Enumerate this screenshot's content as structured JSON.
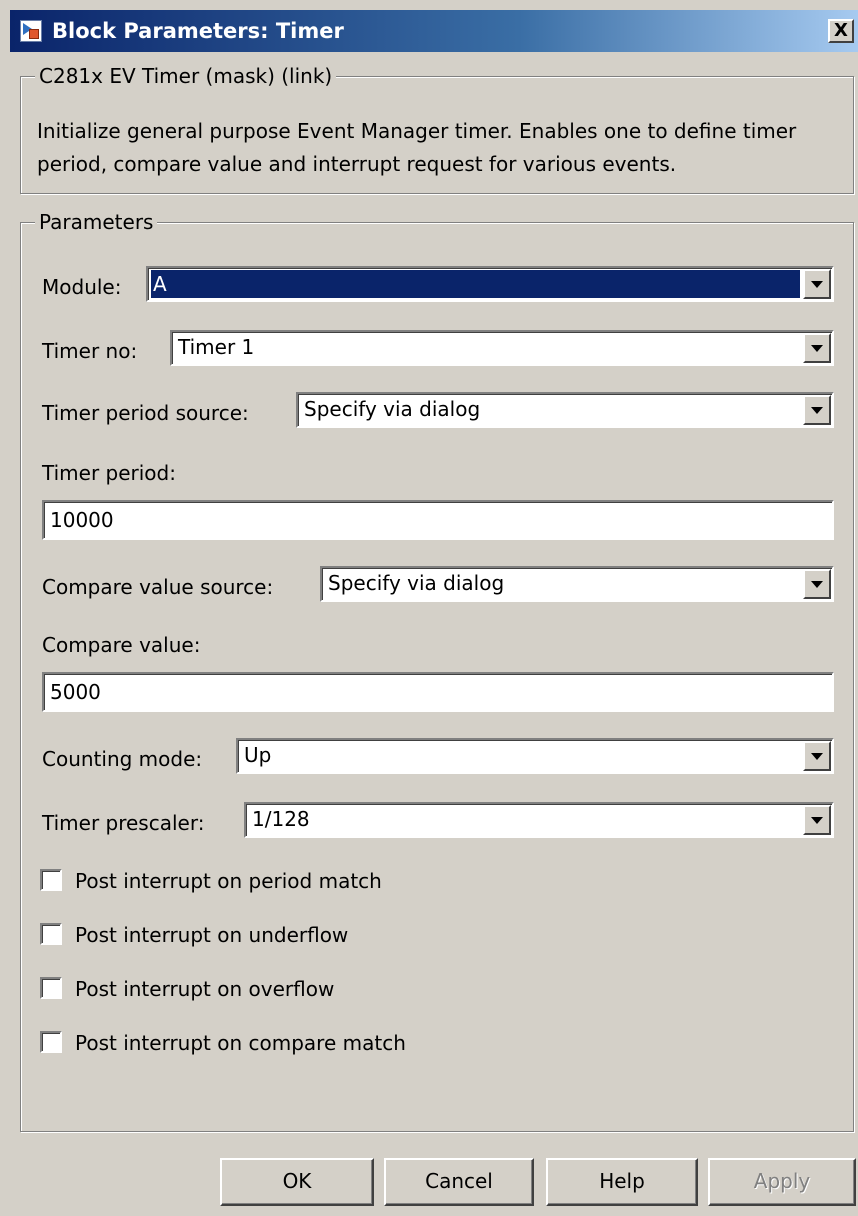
{
  "window": {
    "title": "Block Parameters: Timer",
    "close_label": "X"
  },
  "description": {
    "heading": "C281x EV Timer (mask) (link)",
    "text": "Initialize general purpose Event Manager timer. Enables one to define timer period, compare value and interrupt request for various events."
  },
  "parameters": {
    "heading": "Parameters",
    "module": {
      "label": "Module:",
      "value": "A"
    },
    "timer_no": {
      "label": "Timer no:",
      "value": "Timer 1"
    },
    "timer_period_source": {
      "label": "Timer period source:",
      "value": "Specify via dialog"
    },
    "timer_period": {
      "label": "Timer period:",
      "value": "10000"
    },
    "compare_value_source": {
      "label": "Compare value source:",
      "value": "Specify via dialog"
    },
    "compare_value": {
      "label": "Compare value:",
      "value": "5000"
    },
    "counting_mode": {
      "label": "Counting mode:",
      "value": "Up"
    },
    "timer_prescaler": {
      "label": "Timer prescaler:",
      "value": "1/128"
    },
    "checkboxes": [
      {
        "label": "Post interrupt on period match",
        "checked": false
      },
      {
        "label": "Post interrupt on underflow",
        "checked": false
      },
      {
        "label": "Post interrupt on overflow",
        "checked": false
      },
      {
        "label": "Post interrupt on compare match",
        "checked": false
      }
    ]
  },
  "buttons": {
    "ok": "OK",
    "cancel": "Cancel",
    "help": "Help",
    "apply": "Apply"
  },
  "colors": {
    "dialog_bg": "#d4d0c8",
    "titlebar_start": "#0a246a",
    "selection": "#0a246a"
  }
}
